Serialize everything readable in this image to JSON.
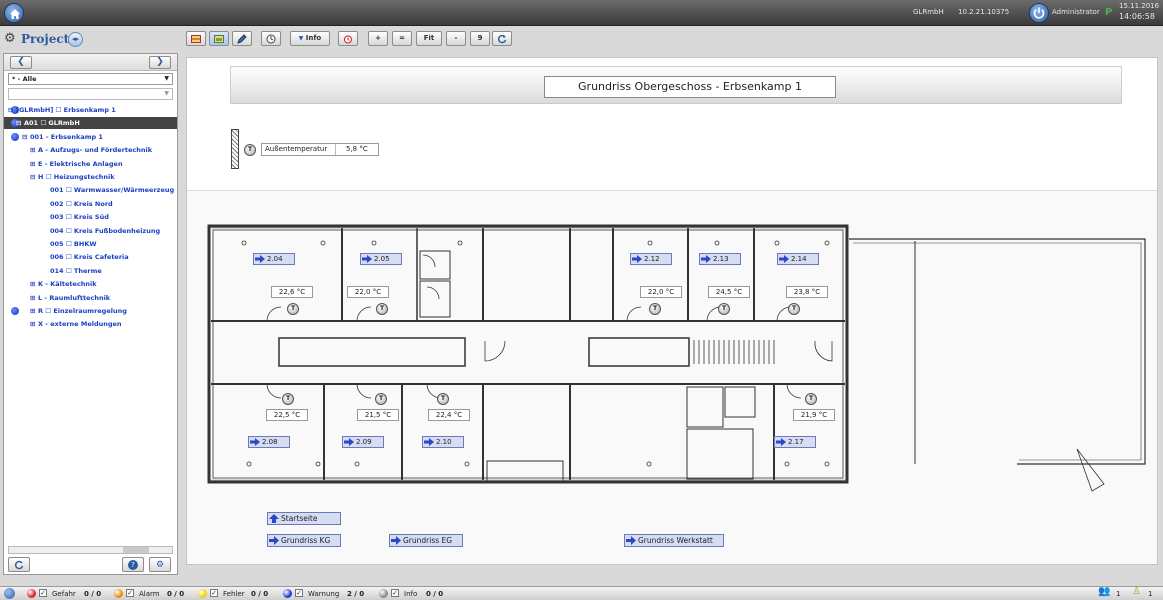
{
  "topbar": {
    "company": "GLRmbH",
    "address": "10.2.21.10375",
    "user": "Administrator",
    "date": "15.11.2016",
    "time": "14:06:58",
    "flag_label": "P"
  },
  "project": {
    "title": "Project"
  },
  "toolbar": {
    "info_label": "Info",
    "zoom_in": "+",
    "zoom_reset": "=",
    "fit": "Fit",
    "zoom_out": "-",
    "zoom_level": "9"
  },
  "left_panel": {
    "filter_value": "* - Alle",
    "tree": [
      {
        "label": "[GLRmbH] ☐ Erbsenkamp 1",
        "dot": true
      },
      {
        "label": "A01 ☐ GLRmbH",
        "dot": true,
        "selected": true
      },
      {
        "label": "001 - Erbsenkamp 1",
        "dot": true
      },
      {
        "label": "A - Aufzugs- und Fördertechnik"
      },
      {
        "label": "E - Elektrische Anlagen"
      },
      {
        "label": "H ☐ Heizungstechnik"
      },
      {
        "label": "001 ☐ Warmwasser/Wärmeerzeug"
      },
      {
        "label": "002 ☐ Kreis Nord"
      },
      {
        "label": "003 ☐ Kreis Süd"
      },
      {
        "label": "004 ☐ Kreis Fußbodenheizung"
      },
      {
        "label": "005 ☐ BHKW"
      },
      {
        "label": "006 ☐ Kreis Cafeteria"
      },
      {
        "label": "014 ☐ Therme"
      },
      {
        "label": "K - Kältetechnik"
      },
      {
        "label": "L - Raumlufttechnik"
      },
      {
        "label": "R ☐ Einzelraumregelung",
        "dot": true
      },
      {
        "label": "X - externe Meldungen"
      }
    ]
  },
  "main": {
    "title": "Grundriss Obergeschoss  -  Erbsenkamp 1",
    "outside": {
      "name": "Außentemperatur",
      "value": "5,8 °C"
    },
    "t_label": "T",
    "rooms": [
      {
        "label": "2.04",
        "temp": "22,6 °C"
      },
      {
        "label": "2.05",
        "temp": "22,0 °C"
      },
      {
        "label": "2.12",
        "temp": "22,0 °C"
      },
      {
        "label": "2.13",
        "temp": "24,5 °C"
      },
      {
        "label": "2.14",
        "temp": "23,8 °C"
      },
      {
        "label": "2.08",
        "temp": "22,5 °C"
      },
      {
        "label": "2.09",
        "temp": "21,5 °C"
      },
      {
        "label": "2.10",
        "temp": "22,4 °C"
      },
      {
        "label": "2.17",
        "temp": "21,9 °C"
      }
    ],
    "links": {
      "start": "Startseite",
      "kg": "Grundriss KG",
      "eg": "Grundriss EG",
      "werkstatt": "Grundriss Werkstatt"
    }
  },
  "statusbar": {
    "gefahr": {
      "label": "Gefahr",
      "count": "0 / 0",
      "color": "#e02020"
    },
    "alarm": {
      "label": "Alarm",
      "count": "0 / 0",
      "color": "#f08a00"
    },
    "fehler": {
      "label": "Fehler",
      "count": "0 / 0",
      "color": "#f2d000"
    },
    "warnung": {
      "label": "Warnung",
      "count": "2 / 0",
      "color": "#1b3fd0"
    },
    "info": {
      "label": "Info",
      "count": "0 / 0",
      "color": "#8a8a8a"
    },
    "users_count": "1",
    "alerts_count": "1"
  }
}
